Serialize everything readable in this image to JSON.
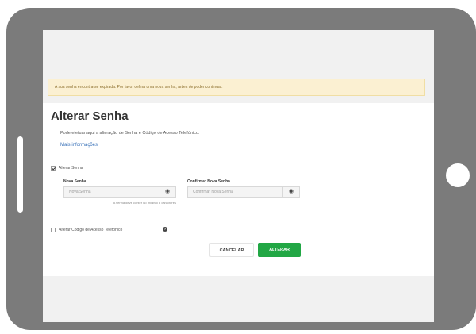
{
  "alert": {
    "text": "A sua senha encontra-se expirada. Por favor defina uma nova senha, antes de poder continuar."
  },
  "page": {
    "title": "Alterar Senha",
    "description": "Pode efetuar aqui a alteração de Senha e Código de Acesso Telefónico.",
    "more_info_link": "Mais informações"
  },
  "form": {
    "change_password": {
      "label": "Alterar Senha",
      "checked": true
    },
    "new_password": {
      "label": "Nova Senha",
      "placeholder": "Nova Senha",
      "hint": "A senha deve conter no mínimo 8 caracteres"
    },
    "confirm_password": {
      "label": "Confirmar Nova Senha",
      "placeholder": "Confirmar Nova Senha"
    },
    "change_phone_code": {
      "label": "Alterar Código de Acesso Telefónico",
      "checked": false
    }
  },
  "buttons": {
    "cancel": "CANCELAR",
    "confirm": "ALTERAR"
  },
  "icons": {
    "show_password": "eye-icon",
    "info": "info-icon"
  },
  "colors": {
    "device_frame": "#7b7b7b",
    "confirm_button": "#22a745",
    "alert_background": "#fbf0d2",
    "link": "#3b73b9"
  }
}
